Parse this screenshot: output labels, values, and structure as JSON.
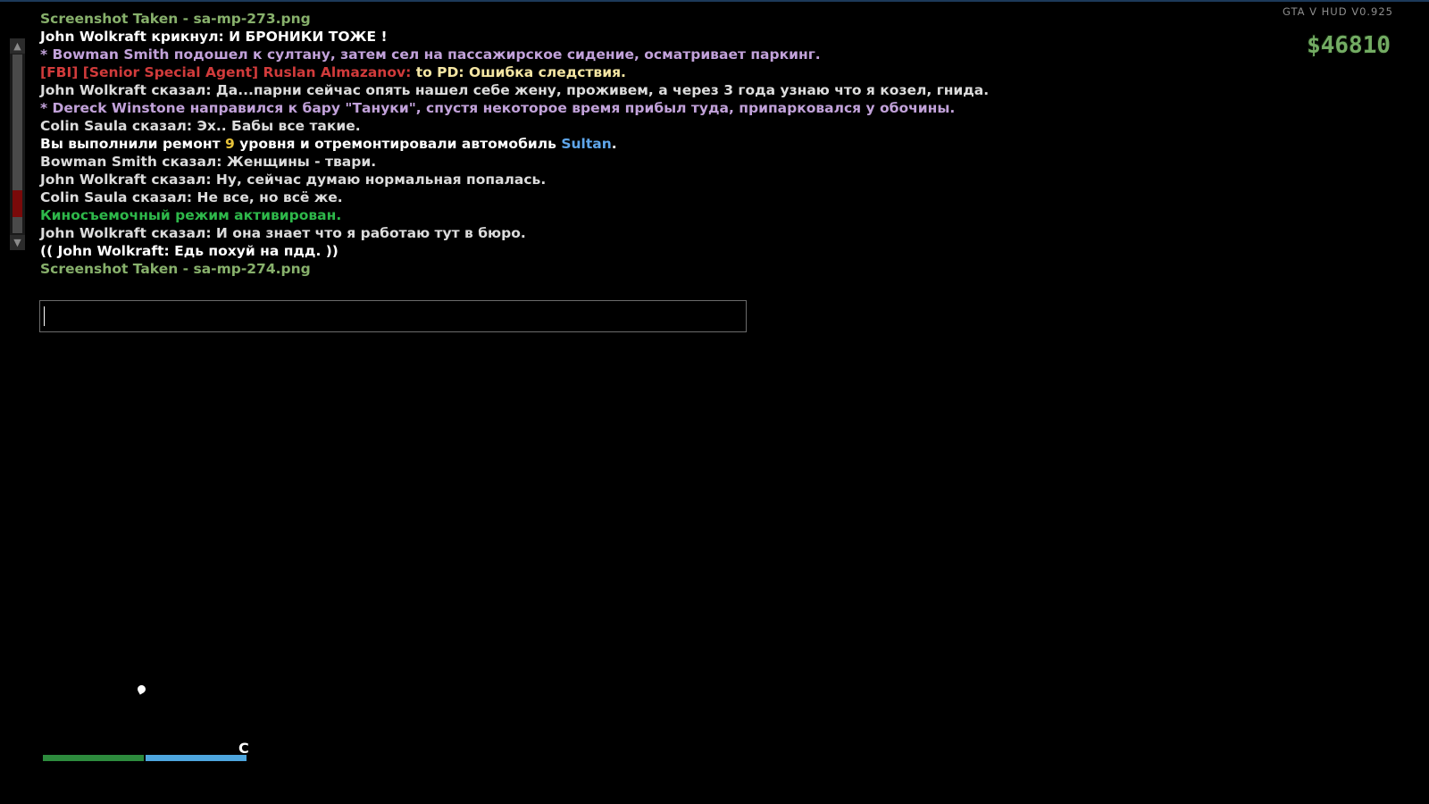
{
  "hud": {
    "version": "GTA V HUD V0.925",
    "money": "$46810",
    "compass_letter": "C",
    "health_fraction": 1.0,
    "armor_fraction": 1.0
  },
  "chat": {
    "lines": [
      [
        {
          "text": "Screenshot Taken - sa-mp-273.png",
          "color": "#87b06b"
        }
      ],
      [
        {
          "text": "John Wolkraft крикнул: И БРОНИКИ ТОЖЕ !",
          "color": "#ffffff"
        }
      ],
      [
        {
          "text": "* Bowman Smith подошел к султану, затем сел на пассажирское сидение, осматривает паркинг.",
          "color": "#c2a2da"
        }
      ],
      [
        {
          "text": "[FBI] [Senior Special Agent] Ruslan Almazanov: ",
          "color": "#d13b3b"
        },
        {
          "text": "to PD: ",
          "color": "#f5e6a3"
        },
        {
          "text": "Ошибка следствия.",
          "color": "#f5e6a3"
        }
      ],
      [
        {
          "text": "John Wolkraft сказал: Да...парни сейчас опять нашел себе жену, проживем, а через 3 года узнаю что я козел, гнида.",
          "color": "#dcdcdc"
        }
      ],
      [
        {
          "text": "* Dereck Winstone направился к бару \"Тануки\", спустя некоторое время прибыл туда, припарковался у обочины.",
          "color": "#c2a2da"
        }
      ],
      [
        {
          "text": "Colin Saula сказал: Эх.. Бабы все такие.",
          "color": "#dcdcdc"
        }
      ],
      [
        {
          "text": "Вы выполнили ремонт ",
          "color": "#ffffff"
        },
        {
          "text": "9",
          "color": "#e8c33a"
        },
        {
          "text": " уровня и отремонтировали автомобиль ",
          "color": "#ffffff"
        },
        {
          "text": "Sultan",
          "color": "#5fa6ea"
        },
        {
          "text": ".",
          "color": "#ffffff"
        }
      ],
      [
        {
          "text": "Bowman Smith сказал: Женщины - твари.",
          "color": "#dcdcdc"
        }
      ],
      [
        {
          "text": "John Wolkraft сказал: Ну, сейчас думаю нормальная попалась.",
          "color": "#dcdcdc"
        }
      ],
      [
        {
          "text": "Colin Saula сказал: Не все, но всё же.",
          "color": "#dcdcdc"
        }
      ],
      [
        {
          "text": "Киносъемочный режим активирован.",
          "color": "#2eb84a"
        }
      ],
      [
        {
          "text": "John Wolkraft сказал: И она знает что я работаю тут в бюро.",
          "color": "#dcdcdc"
        }
      ],
      [
        {
          "text": "(( John Wolkraft: Едь похуй на пдд. ))",
          "color": "#ffffff"
        }
      ],
      [
        {
          "text": "Screenshot Taken - sa-mp-274.png",
          "color": "#87b06b"
        }
      ]
    ],
    "input_value": "",
    "scroll_up_glyph": "▲",
    "scroll_down_glyph": "▼"
  }
}
